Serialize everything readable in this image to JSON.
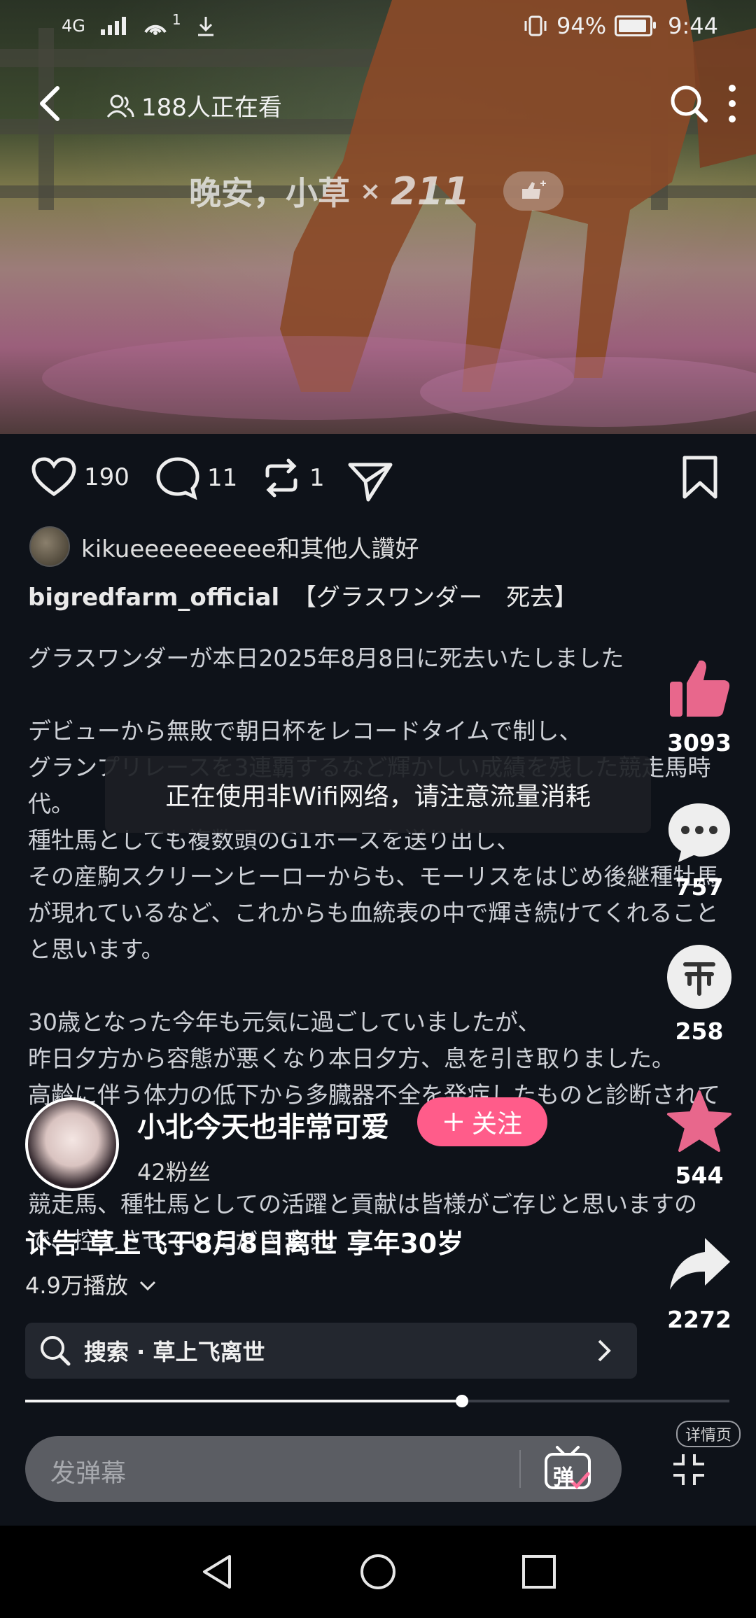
{
  "status_bar": {
    "network": "4G",
    "signal_note": "1",
    "battery_percent_text": "94%",
    "battery_level": 0.94,
    "time": "9:44"
  },
  "top_bar": {
    "viewers_text": "188人正在看"
  },
  "gift_notice": {
    "text": "晚安，小草",
    "multiplier": "×",
    "count": "211"
  },
  "actions": {
    "likes": "190",
    "comments": "11",
    "reposts": "1"
  },
  "post": {
    "liked_by": "kikueeeeeeeeee和其他人讚好",
    "account": "bigredfarm_official",
    "headline": "【グラスワンダー　死去】",
    "body": "グラスワンダーが本日2025年8月8日に死去いたしました\n\nデビューから無敗で朝日杯をレコードタイムで制し、\nグランプリレースを3連覇するなど輝かしい成績を残した競走馬時代。\n種牡馬としても複数頭のG1ホースを送り出し、\nその産駒スクリーンヒーローからも、モーリスをはじめ後継種牡馬が現れているなど、これからも血統表の中で輝き続けてくれることと思います。\n\n30歳となった今年も元気に過ごしていましたが、\n昨日夕方から容態が悪くなり本日夕方、息を引き取りました。\n高齢に伴う体力の低下から多臓器不全を発症したものと診断されています。\n\n競走馬、種牡馬としての活躍と貢献は皆様がご存じと思いますので、控えさせていただきます。"
  },
  "toast": "正在使用非Wifi网络，请注意流量消耗",
  "right_rail": {
    "likes": "3093",
    "comments": "757",
    "coins": "258",
    "favorites": "544",
    "shares": "2272"
  },
  "uploader": {
    "name": "小北今天也非常可爱",
    "fans": "42粉丝",
    "follow_label": "关注"
  },
  "video": {
    "title": "讣告 草上飞于8月8日离世 享年30岁",
    "plays": "4.9万播放",
    "progress": 0.62
  },
  "search": {
    "text": "搜索 · 草上飞离世"
  },
  "bottom": {
    "danmu_placeholder": "发弹幕",
    "danmu_icon_label": "弹",
    "detail_label": "详情页"
  },
  "colors": {
    "background": "#0e1219",
    "follow_button": "#ff5c8a",
    "like_pink": "#e8678c"
  }
}
